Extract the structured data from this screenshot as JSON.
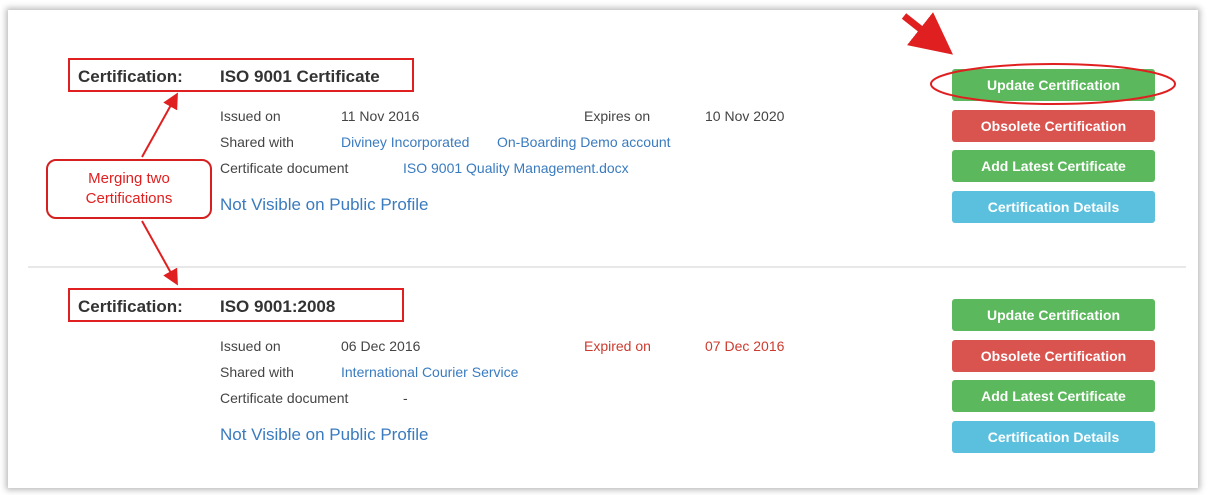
{
  "certifications": [
    {
      "label": "Certification:",
      "name": "ISO 9001 Certificate",
      "issued_label": "Issued on",
      "issued_date": "11 Nov 2016",
      "expiry_label": "Expires on",
      "expiry_date": "10 Nov 2020",
      "shared_label": "Shared with",
      "shared_with": [
        "Diviney Incorporated",
        "On-Boarding Demo account"
      ],
      "doc_label": "Certificate document",
      "doc_value": "ISO 9001 Quality Management.docx",
      "visibility": "Not Visible on Public Profile",
      "buttons": {
        "update": "Update Certification",
        "obsolete": "Obsolete Certification",
        "add_latest": "Add Latest Certificate",
        "details": "Certification Details"
      }
    },
    {
      "label": "Certification:",
      "name": "ISO 9001:2008",
      "issued_label": "Issued on",
      "issued_date": "06 Dec 2016",
      "expiry_label": "Expired on",
      "expiry_date": "07 Dec 2016",
      "shared_label": "Shared with",
      "shared_with": [
        "International Courier Service"
      ],
      "doc_label": "Certificate document",
      "doc_value": "-",
      "visibility": "Not Visible on Public Profile",
      "buttons": {
        "update": "Update Certification",
        "obsolete": "Obsolete Certification",
        "add_latest": "Add Latest Certificate",
        "details": "Certification Details"
      }
    }
  ],
  "annotation": {
    "callout_line1": "Merging two",
    "callout_line2": "Certifications"
  },
  "colors": {
    "annotation_red": "#e02020",
    "link_blue": "#3a7bbf",
    "expired_red": "#cc3b2f",
    "btn_green": "#5cb85c",
    "btn_red": "#d9534f",
    "btn_blue": "#5bc0de"
  }
}
